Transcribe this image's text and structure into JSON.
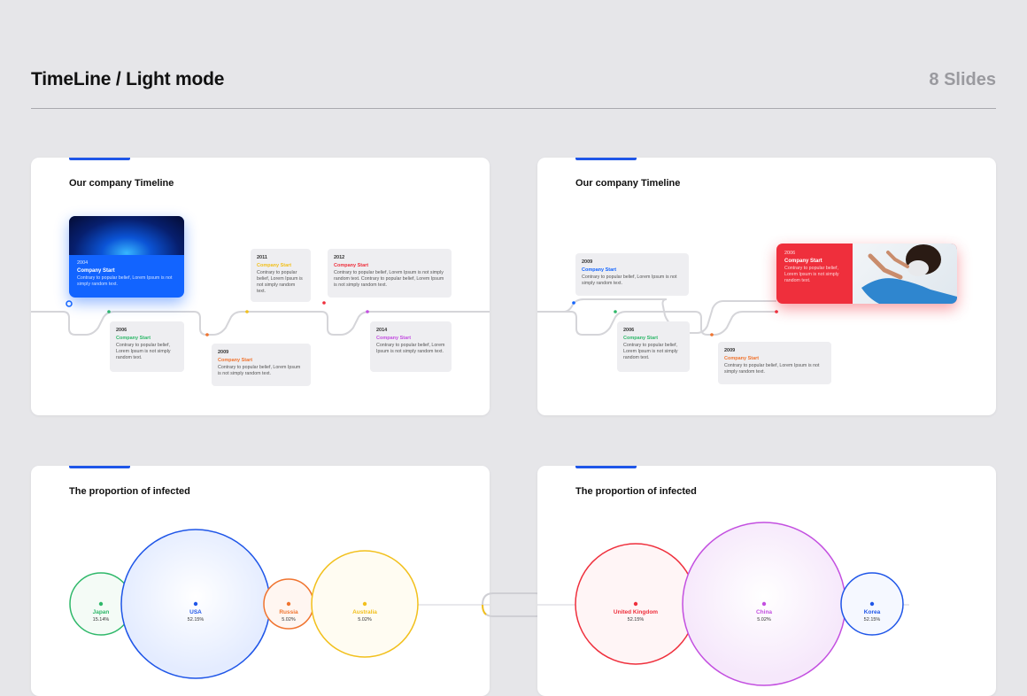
{
  "header": {
    "title": "TimeLine / Light mode",
    "slide_count": "8 Slides"
  },
  "colors": {
    "accent": "#1f56e8",
    "blue": "#1264ff",
    "green": "#2fb86a",
    "orange": "#f0742f",
    "yellow": "#f2c01c",
    "red": "#ef2f3c",
    "purple": "#c34fe0"
  },
  "slide1": {
    "heading": "Our company Timeline",
    "highlight": {
      "year": "2004",
      "label": "Company Start",
      "desc": "Contrary to popular belief, Lorem Ipsum is not simply random text."
    },
    "items": [
      {
        "year": "2006",
        "label": "Company Start",
        "desc": "Contrary to popular belief, Lorem Ipsum is not simply random text."
      },
      {
        "year": "2009",
        "label": "Company Start",
        "desc": "Contrary to popular belief, Lorem Ipsum is not simply random text."
      },
      {
        "year": "2011",
        "label": "Company Start",
        "desc": "Contrary to popular belief, Lorem Ipsum is not simply random text."
      },
      {
        "year": "2012",
        "label": "Company Start",
        "desc": "Contrary to popular belief, Lorem Ipsum is not simply random text. Contrary to popular belief, Lorem Ipsum is not simply random text."
      },
      {
        "year": "2014",
        "label": "Company Start",
        "desc": "Contrary to popular belief, Lorem Ipsum is not simply random text."
      }
    ]
  },
  "slide2": {
    "heading": "Our company Timeline",
    "items": [
      {
        "year": "2009",
        "label": "Company Start",
        "desc": "Contrary to popular belief, Lorem Ipsum is not simply random text."
      },
      {
        "year": "2006",
        "label": "Company Start",
        "desc": "Contrary to popular belief, Lorem Ipsum is not simply random text."
      },
      {
        "year": "2009",
        "label": "Company Start",
        "desc": "Contrary to popular belief, Lorem Ipsum is not simply random text."
      }
    ],
    "highlight": {
      "year": "2006",
      "label": "Company Start",
      "desc": "Contrary to popular belief, Lorem Ipsum is not simply random text."
    }
  },
  "slide3": {
    "heading": "The proportion of infected",
    "bubbles": [
      {
        "name": "Japan",
        "value": "15.14%"
      },
      {
        "name": "USA",
        "value": "52.15%"
      },
      {
        "name": "Russia",
        "value": "5.02%"
      },
      {
        "name": "Australia",
        "value": "5.02%"
      }
    ]
  },
  "slide4": {
    "heading": "The proportion of infected",
    "bubbles": [
      {
        "name": "United Kingdom",
        "value": "52.15%"
      },
      {
        "name": "China",
        "value": "5.02%"
      },
      {
        "name": "Korea",
        "value": "52.15%"
      }
    ]
  }
}
